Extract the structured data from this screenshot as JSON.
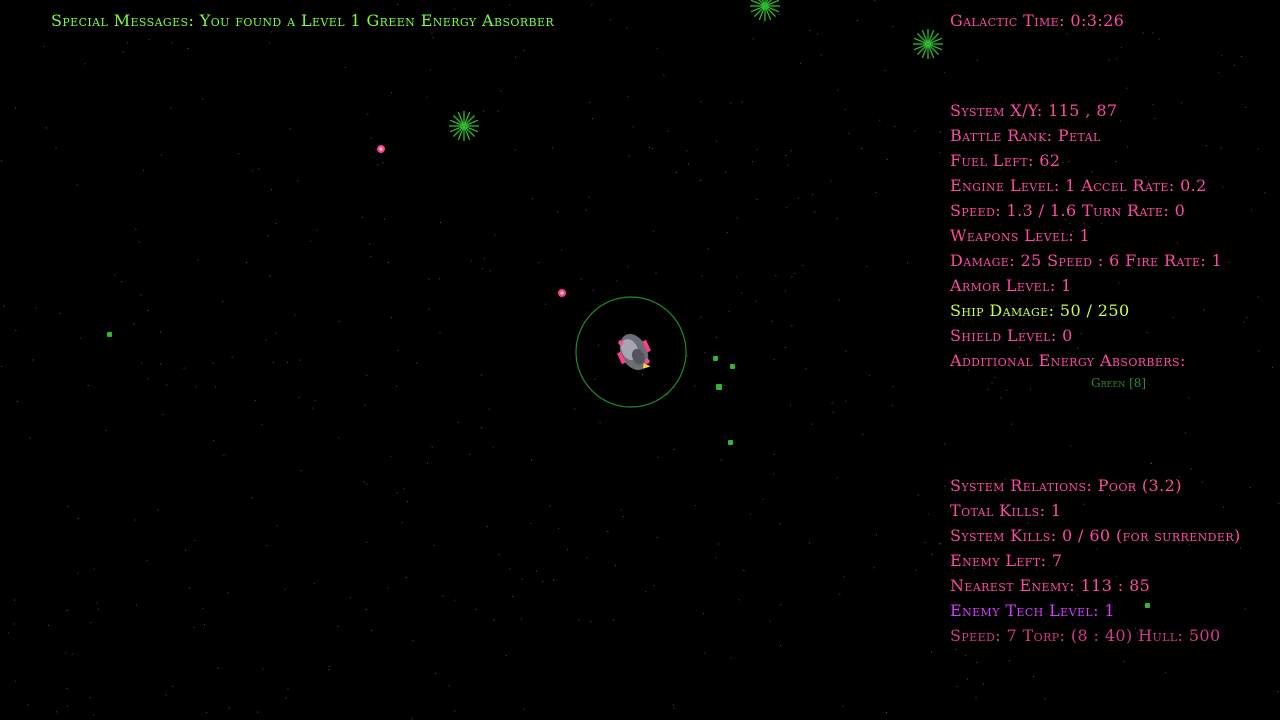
{
  "special_message": "Special Messages: You found a Level 1 Green Energy Absorber",
  "galactic_time": "Galactic Time: 0:3:26",
  "stats": {
    "system_xy": "System X/Y:  115 ,  87",
    "battle_rank": "Battle Rank: Petal",
    "fuel_left": "Fuel Left:  62",
    "engine": "Engine Level: 1  Accel Rate: 0.2",
    "speed": "Speed: 1.3 / 1.6  Turn Rate: 0",
    "weapons": "Weapons Level: 1",
    "damage": "Damage: 25 Speed : 6  Fire Rate: 1",
    "armor": "Armor Level: 1",
    "ship_damage": "Ship Damage: 50  /  250",
    "shield": "Shield Level: 0",
    "absorbers_label": "Additional Energy Absorbers:",
    "absorbers_value": "Green [8]"
  },
  "system": {
    "relations": "System Relations: Poor   (3.2)",
    "total_kills": "Total Kills: 1",
    "system_kills": "System Kills: 0  /  60  (for surrender)",
    "enemy_left": "Enemy Left:  7",
    "nearest_enemy": "Nearest Enemy: 113 : 85",
    "enemy_tech": "Enemy Tech Level:  1",
    "enemy_specs": "Speed: 7  Torp: (8 : 40)  Hull: 500"
  },
  "colors": {
    "message": "#7dff3a",
    "stat_text": "#ff4aa0",
    "ship_damage": "#c8ff4a",
    "enemy_tech": "#d63cff",
    "absorber": "#2c8c2c",
    "background": "#000000"
  }
}
